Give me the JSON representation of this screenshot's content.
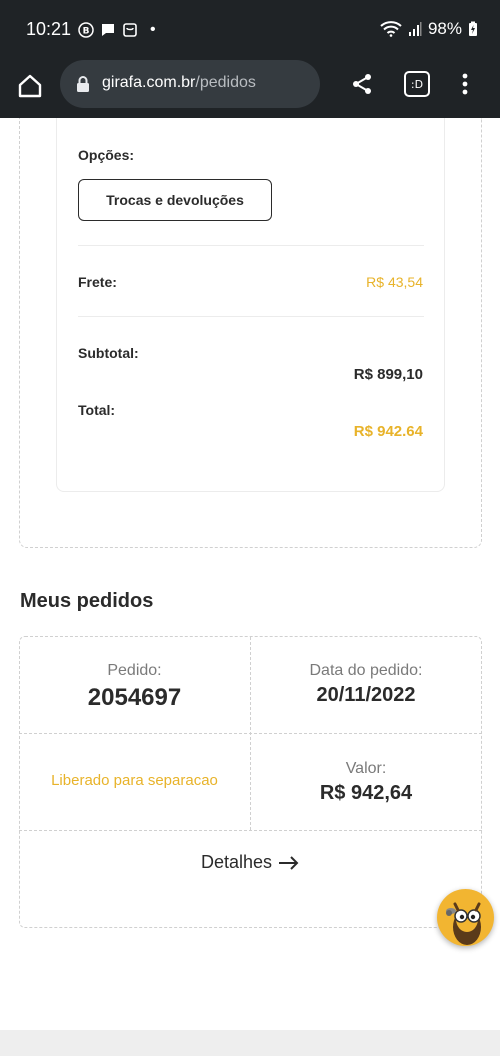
{
  "status_bar": {
    "time": "10:21",
    "battery": "98%",
    "dot": "•"
  },
  "browser": {
    "url_domain": "girafa.com.br",
    "url_path": "/pedidos",
    "tabs_label": ":D"
  },
  "summary": {
    "options_label": "Opções:",
    "exchange_button": "Trocas e devoluções",
    "shipping_label": "Frete:",
    "shipping_value": "R$ 43,54",
    "subtotal_label": "Subtotal:",
    "subtotal_value": "R$ 899,10",
    "total_label": "Total:",
    "total_value": "R$ 942.64"
  },
  "orders": {
    "title": "Meus pedidos",
    "order_caption": "Pedido:",
    "order_number": "2054697",
    "date_caption": "Data do pedido:",
    "date_value": "20/11/2022",
    "status": "Liberado para separacao",
    "value_caption": "Valor:",
    "value": "R$ 942,64",
    "details_link": "Detalhes"
  },
  "colors": {
    "accent": "#e8b32a",
    "toolbar": "#1f2326",
    "text": "#2b2b2b"
  },
  "icons": [
    "home-icon",
    "lock-icon",
    "share-icon",
    "tab-switcher-icon",
    "more-vert-icon",
    "wifi-icon",
    "signal-icon",
    "battery-icon",
    "arrow-right-icon",
    "giraffe-mascot-icon"
  ]
}
